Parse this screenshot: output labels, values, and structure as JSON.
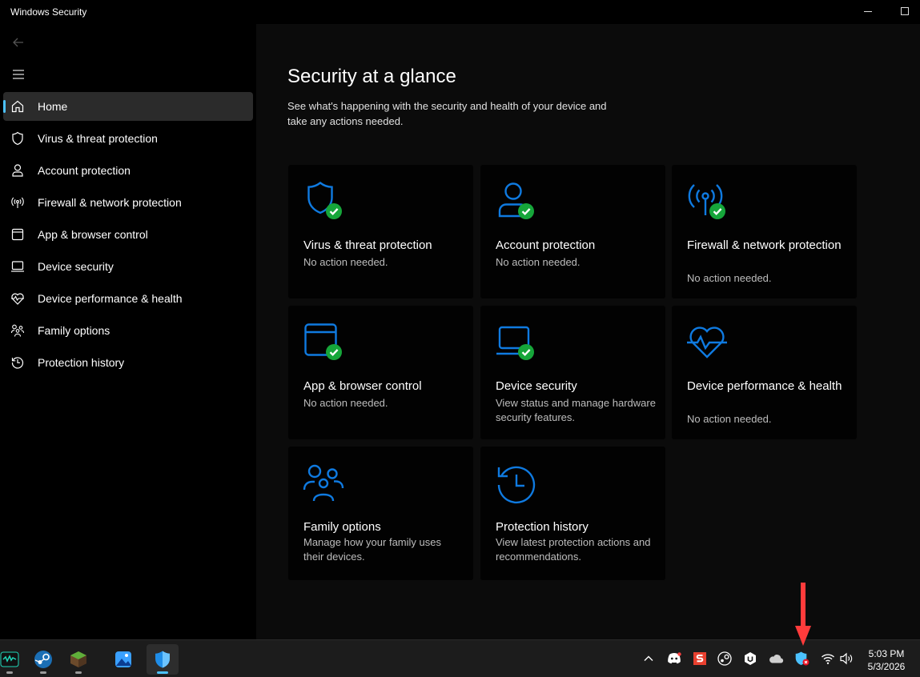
{
  "window": {
    "title": "Windows Security"
  },
  "sidebar": {
    "items": [
      {
        "label": "Home",
        "icon": "home-icon",
        "active": true
      },
      {
        "label": "Virus & threat protection",
        "icon": "shield-icon"
      },
      {
        "label": "Account protection",
        "icon": "person-icon"
      },
      {
        "label": "Firewall & network protection",
        "icon": "antenna-icon"
      },
      {
        "label": "App & browser control",
        "icon": "browser-window-icon"
      },
      {
        "label": "Device security",
        "icon": "laptop-icon"
      },
      {
        "label": "Device performance & health",
        "icon": "heart-pulse-icon"
      },
      {
        "label": "Family options",
        "icon": "family-icon"
      },
      {
        "label": "Protection history",
        "icon": "history-icon"
      }
    ]
  },
  "main": {
    "title": "Security at a glance",
    "subtitle": "See what's happening with the security and health of your device and take any actions needed.",
    "cards": [
      {
        "title": "Virus & threat protection",
        "desc": "No action needed.",
        "icon": "shield-icon",
        "status": "ok"
      },
      {
        "title": "Account protection",
        "desc": "No action needed.",
        "icon": "person-icon",
        "status": "ok"
      },
      {
        "title": "Firewall & network protection",
        "desc": "No action needed.",
        "icon": "antenna-icon",
        "status": "ok"
      },
      {
        "title": "App & browser control",
        "desc": "No action needed.",
        "icon": "browser-window-icon",
        "status": "ok"
      },
      {
        "title": "Device security",
        "desc": "View status and manage hardware security features.",
        "icon": "laptop-icon",
        "status": "ok"
      },
      {
        "title": "Device performance & health",
        "desc": "No action needed.",
        "icon": "heart-pulse-icon",
        "status": "none"
      },
      {
        "title": "Family options",
        "desc": "Manage how your family uses their devices.",
        "icon": "family-icon",
        "status": "none"
      },
      {
        "title": "Protection history",
        "desc": "View latest protection actions and recommendations.",
        "icon": "history-icon",
        "status": "none"
      }
    ]
  },
  "taskbar": {
    "apps": [
      "audio-waveform-app-icon",
      "steam-app-icon",
      "minecraft-app-icon",
      "photos-app-icon",
      "windows-security-app-icon"
    ],
    "tray": [
      "chevron-up-icon",
      "discord-icon",
      "s-app-icon",
      "steam-tray-icon",
      "hex-app-icon",
      "onedrive-icon",
      "security-warning-icon",
      "wifi-icon",
      "volume-icon"
    ],
    "time": "5:03 PM",
    "date": "5/3/2026"
  },
  "colors": {
    "accent": "#0078d4",
    "accent_light": "#4cc2ff",
    "ok_green": "#16a63a",
    "alert_red": "#ff3b3b"
  }
}
